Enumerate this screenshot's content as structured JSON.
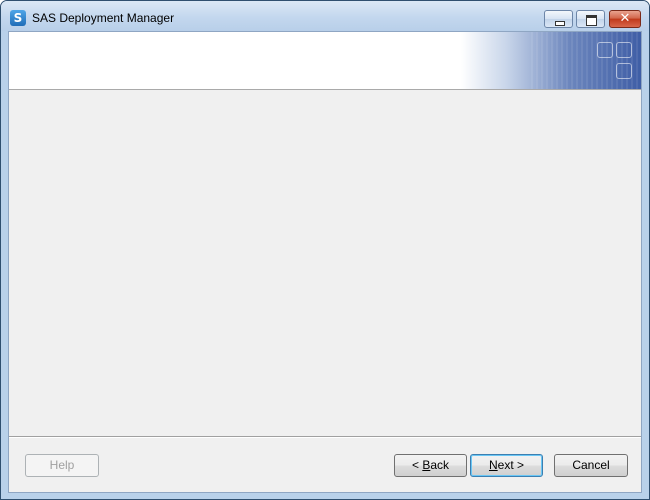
{
  "window": {
    "title": "SAS Deployment Manager",
    "app_icon_letter": "S"
  },
  "titlebar_controls": {
    "close_glyph": "✕"
  },
  "footer": {
    "help": {
      "label": "Help",
      "enabled": false
    },
    "back": {
      "prefix": "< ",
      "accel": "B",
      "rest": "ack"
    },
    "next": {
      "accel": "N",
      "rest": "ext >",
      "default": true
    },
    "cancel": {
      "label": "Cancel"
    }
  },
  "colors": {
    "titlebar": "#c3d7ee",
    "client_background": "#f0f0f0",
    "banner_background": "#ffffff",
    "banner_accent": "#3f5ea6",
    "close_button": "#c0391b"
  }
}
